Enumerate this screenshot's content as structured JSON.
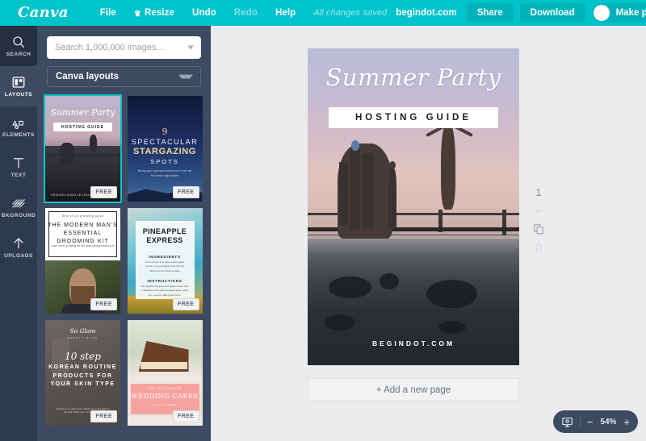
{
  "app": {
    "logo": "Canva",
    "brand_color": "#00c4cc"
  },
  "topbar": {
    "menu": [
      {
        "label": "File",
        "icon": null,
        "dim": false
      },
      {
        "label": "Resize",
        "icon": "crown-icon",
        "dim": false
      },
      {
        "label": "Undo",
        "icon": null,
        "dim": false
      },
      {
        "label": "Redo",
        "icon": null,
        "dim": true
      },
      {
        "label": "Help",
        "icon": null,
        "dim": false
      }
    ],
    "status": "All changes saved",
    "account_name": "begindot.com",
    "share_label": "Share",
    "download_label": "Download",
    "make_public_label": "Make public"
  },
  "rail": {
    "items": [
      {
        "label": "SEARCH",
        "icon": "search-icon",
        "state": "shaded"
      },
      {
        "label": "LAYOUTS",
        "icon": "layouts-icon",
        "state": "active"
      },
      {
        "label": "ELEMENTS",
        "icon": "elements-icon",
        "state": "normal"
      },
      {
        "label": "TEXT",
        "icon": "text-icon",
        "state": "normal"
      },
      {
        "label": "BKGROUND",
        "icon": "background-icon",
        "state": "normal"
      },
      {
        "label": "UPLOADS",
        "icon": "upload-icon",
        "state": "normal"
      }
    ]
  },
  "panel": {
    "search_placeholder": "Search 1,000,000 images...",
    "search_value": "",
    "category_label": "Canva layouts",
    "free_badge": "FREE",
    "thumbnails": [
      {
        "id": "summer-party",
        "selected": true,
        "title": "Summer Party",
        "subtitle": "HOSTING GUIDE",
        "footer": "TRAVELANDLEISURE.COM"
      },
      {
        "id": "stargazing",
        "selected": false,
        "number": "9",
        "line1": "SPECTACULAR",
        "line2": "STARGAZING",
        "line3": "SPOTS",
        "blurb": "Bring your special someone to see all the best night skies"
      },
      {
        "id": "grooming-kit",
        "selected": false,
        "kicker": "Best of our grooming guide",
        "title": "THE MODERN MAN'S ESSENTIAL GROOMING KIT",
        "caption": "Learn more by visiting the link www.mensgroomers.com"
      },
      {
        "id": "pineapple-express",
        "selected": false,
        "title": "PINEAPPLE EXPRESS",
        "heading1": "INGREDIENTS",
        "body1": "1/2 cup fresh lime juice\n2 tbsp agave nectar\n1 cup pineapple juice\n1/2 cup white rum\nIce cubes to taste",
        "heading2": "INSTRUCTIONS",
        "body2": "Stir together the juice and agave nectar until it dissolves, then add pineapple juice, white rum, and ice. Blend and serve."
      },
      {
        "id": "korean-skincare",
        "selected": false,
        "brand": "So Glam",
        "brand_sub": "BEAUTY BLOG",
        "number": "10 step",
        "lines": "KOREAN ROUTINE PRODUCTS FOR YOUR SKIN TYPE",
        "caption": "Curated by our glam team. Check out our full guide on the blog. Share your own tips with us."
      },
      {
        "id": "wedding-cakes",
        "selected": false,
        "kicker": "TOP 10 ELEGANT",
        "title": "WEDDING CAKES",
        "subtitle": "THIS YEAR"
      }
    ]
  },
  "canvas": {
    "design_title": "Summer Party",
    "design_subtitle": "HOSTING GUIDE",
    "design_footer": "BEGINDOT.COM",
    "add_page_label": "+ Add a new page"
  },
  "page_tools": {
    "page_number": "1",
    "up_icon": "chevron-up-icon",
    "down_icon": "chevron-down-icon",
    "duplicate_icon": "duplicate-page-icon",
    "delete_icon": "trash-icon"
  },
  "zoom_control": {
    "present_icon": "present-icon",
    "minus_label": "−",
    "value": "54%",
    "plus_label": "+"
  }
}
